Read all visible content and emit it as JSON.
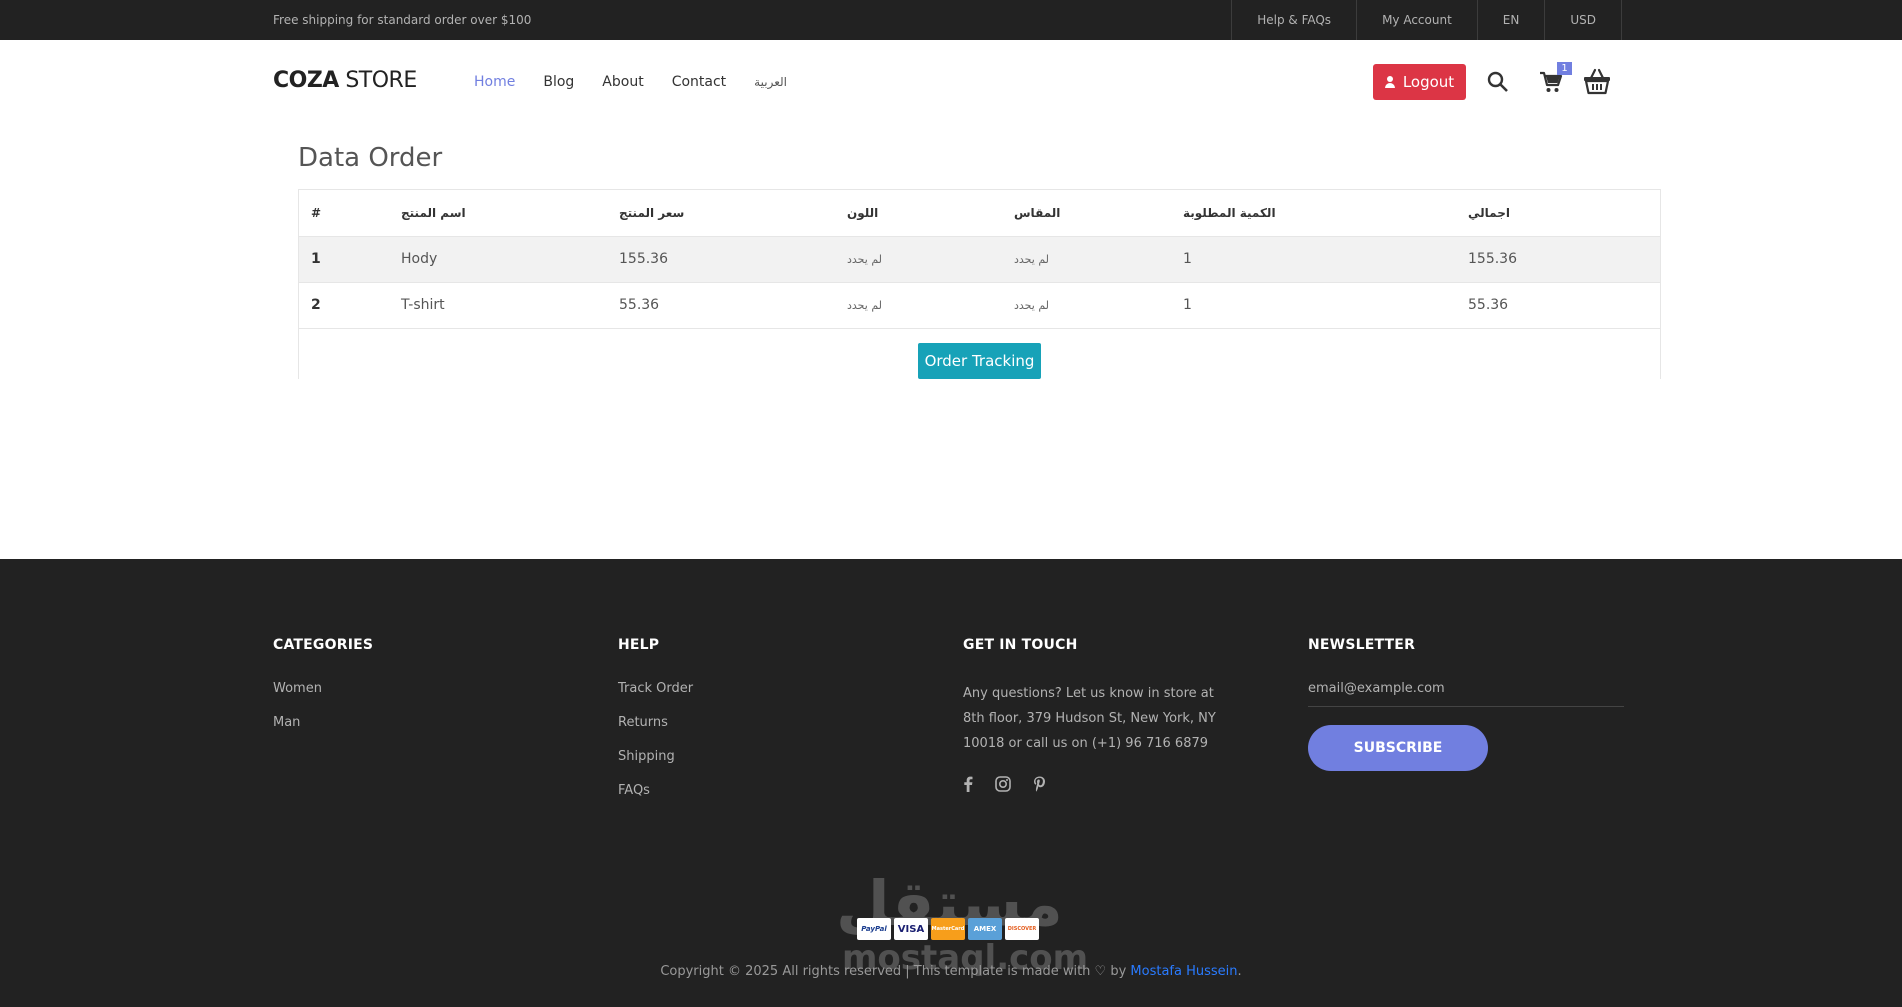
{
  "topbar": {
    "promo": "Free shipping for standard order over $100",
    "links": [
      "Help & FAQs",
      "My Account",
      "EN",
      "USD"
    ]
  },
  "header": {
    "logo_bold": "COZA",
    "logo_light": " STORE",
    "nav": [
      "Home",
      "Blog",
      "About",
      "Contact",
      "العربية"
    ],
    "active_nav": "Home",
    "logout_label": "Logout",
    "cart_count": "1",
    "icons": [
      "user-icon",
      "search-icon",
      "cart-icon",
      "basket-icon"
    ]
  },
  "main": {
    "title": "Data Order",
    "columns": [
      "#",
      "اسم المنتج",
      "سعر المنتج",
      "اللون",
      "المقاس",
      "الكمية المطلوبة",
      "اجمالي"
    ],
    "rows": [
      [
        "1",
        "Hody",
        "155.36",
        "لم يحدد",
        "لم يحدد",
        "1",
        "155.36"
      ],
      [
        "2",
        "T-shirt",
        "55.36",
        "لم يحدد",
        "لم يحدد",
        "1",
        "55.36"
      ]
    ],
    "track_button": "Order Tracking"
  },
  "footer": {
    "categories": {
      "title": "CATEGORIES",
      "items": [
        "Women",
        "Man"
      ]
    },
    "help": {
      "title": "HELP",
      "items": [
        "Track Order",
        "Returns",
        "Shipping",
        "FAQs"
      ]
    },
    "contact": {
      "title": "GET IN TOUCH",
      "text": "Any questions? Let us know in store at 8th floor, 379 Hudson St, New York, NY 10018 or call us on (+1) 96 716 6879",
      "socials": [
        "facebook-icon",
        "instagram-icon",
        "pinterest-icon"
      ]
    },
    "newsletter": {
      "title": "NEWSLETTER",
      "placeholder": "email@example.com",
      "button": "SUBSCRIBE"
    },
    "payments": [
      "PayPal",
      "VISA",
      "MasterCard",
      "AMEX",
      "DISCOVER"
    ],
    "copyright_prefix": "Copyright © 2025 All rights reserved | This template is made with ",
    "copyright_by": " by ",
    "author": "Mostafa Hussein",
    "copyright_end": ".",
    "watermark_ar": "مستقل",
    "watermark_en": "mostaql.com"
  },
  "colors": {
    "accent": "#717fe0",
    "danger": "#dc3545",
    "teal": "#17a2b8",
    "dark": "#222222"
  }
}
